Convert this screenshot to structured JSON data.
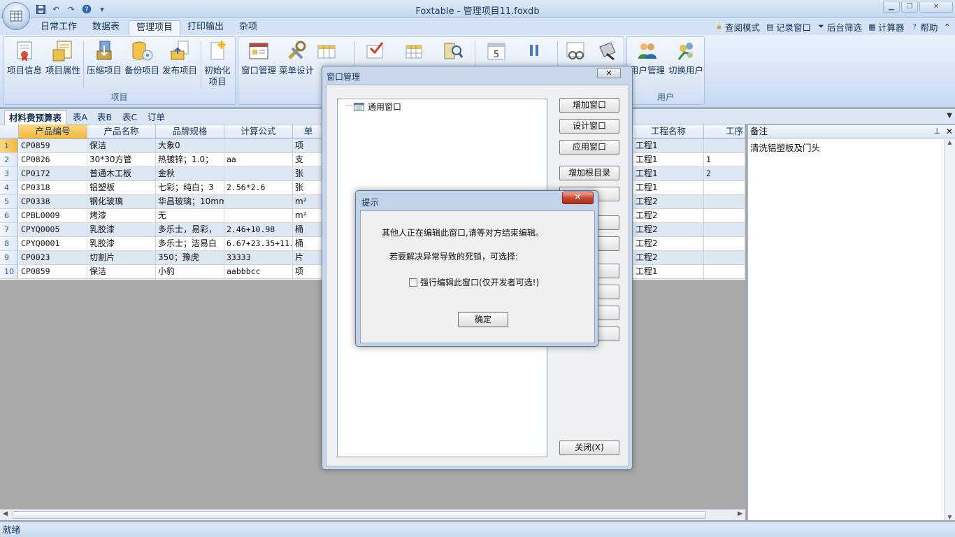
{
  "titlebar": {
    "title": "Foxtable - 管理项目11.foxdb",
    "qat_icons": [
      "save-icon",
      "undo-icon",
      "redo-icon",
      "help-icon",
      "qat-dropdown-icon"
    ]
  },
  "menu_tabs": [
    "日常工作",
    "数据表",
    "管理项目",
    "打印输出",
    "杂项"
  ],
  "active_tab": "管理项目",
  "right_tools": [
    "查阅模式",
    "记录窗口",
    "后台筛选",
    "计算器",
    "帮助"
  ],
  "ribbon": {
    "group_project": {
      "label": "项目",
      "buttons": [
        "项目信息",
        "项目属性",
        "压缩项目",
        "备份项目",
        "发布项目",
        "初始化项目"
      ]
    },
    "group_window": {
      "buttons": [
        "窗口管理",
        "菜单设计"
      ]
    },
    "group_user": {
      "label": "用户",
      "buttons": [
        "用户管理",
        "切换用户"
      ]
    }
  },
  "sheet_tabs": [
    "材料费预算表",
    "表A",
    "表B",
    "表C",
    "订单"
  ],
  "active_sheet": "材料费预算表",
  "grid": {
    "columns": [
      "产品编号",
      "产品名称",
      "品牌规格",
      "计算公式",
      "单",
      "工程名称",
      "工序"
    ],
    "rows": [
      {
        "n": "1",
        "code": "CP0859",
        "name": "保洁",
        "brand": "大象0",
        "formula": "",
        "unit": "项",
        "project": "工程1",
        "step": ""
      },
      {
        "n": "2",
        "code": "CP0826",
        "name": "30*30方管",
        "brand": "热镀锌；1.0；",
        "formula": "aa",
        "unit": "支",
        "project": "工程1",
        "step": "1"
      },
      {
        "n": "3",
        "code": "CP0172",
        "name": "普通木工板",
        "brand": "金秋",
        "formula": "",
        "unit": "张",
        "project": "工程1",
        "step": "2"
      },
      {
        "n": "4",
        "code": "CP0318",
        "name": "铝塑板",
        "brand": "七彩；纯白；3",
        "formula": "2.56*2.6",
        "unit": "张",
        "project": "工程1",
        "step": ""
      },
      {
        "n": "5",
        "code": "CP0338",
        "name": "钢化玻璃",
        "brand": "华昌玻璃；10mm",
        "formula": "",
        "unit": "m²",
        "project": "工程2",
        "step": ""
      },
      {
        "n": "6",
        "code": "CPBL0009",
        "name": "烤漆",
        "brand": "无",
        "formula": "",
        "unit": "m²",
        "project": "工程2",
        "step": ""
      },
      {
        "n": "7",
        "code": "CPYQ0005",
        "name": "乳胶漆",
        "brand": "多乐士，易彩，",
        "formula": "2.46+10.98",
        "unit": "桶",
        "project": "工程2",
        "step": ""
      },
      {
        "n": "8",
        "code": "CPYQ0001",
        "name": "乳胶漆",
        "brand": "多乐士；洁易白",
        "formula": "6.67+23.35+11.",
        "unit": "桶",
        "project": "工程2",
        "step": ""
      },
      {
        "n": "9",
        "code": "CP0023",
        "name": "切割片",
        "brand": "350；豫虎",
        "formula": "33333",
        "unit": "片",
        "project": "工程2",
        "step": ""
      },
      {
        "n": "10",
        "code": "CP0859",
        "name": "保洁",
        "brand": "小豹",
        "formula": "aabbbcc",
        "unit": "项",
        "project": "工程1",
        "step": ""
      }
    ]
  },
  "note_panel": {
    "header": "备注",
    "text": "清洗铝塑板及门头"
  },
  "status": "就绪",
  "window_manager": {
    "title": "窗口管理",
    "tree_root": "通用窗口",
    "buttons": [
      "增加窗口",
      "设计窗口",
      "应用窗口",
      "增加根目录",
      "关闭(X)"
    ]
  },
  "prompt": {
    "title": "提示",
    "message1": "其他人正在编辑此窗口,请等对方结束编辑。",
    "message2": "若要解决异常导致的死锁，可选择:",
    "checkbox_label": "强行编辑此窗口(仅开发者可选!)",
    "checkbox_checked": false,
    "ok_label": "确定"
  },
  "colors": {
    "ribbon": "#d3e2f4",
    "selected_header": "#f8c663",
    "row_alt": "#dde8f4",
    "close_red": "#c7412a"
  }
}
